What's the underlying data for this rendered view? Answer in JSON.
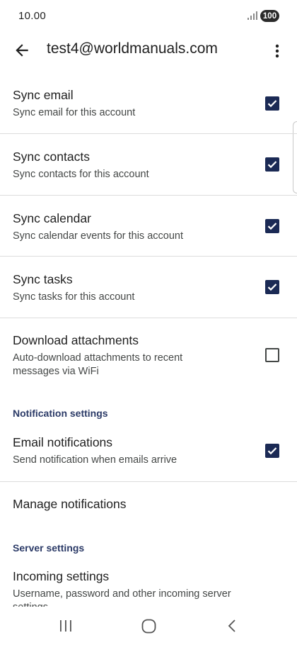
{
  "status_bar": {
    "time": "10.00",
    "battery": "100"
  },
  "app_bar": {
    "title": "test4@worldmanuals.com"
  },
  "settings": [
    {
      "title": "Sync email",
      "subtitle": "Sync email for this account",
      "checked": true
    },
    {
      "title": "Sync contacts",
      "subtitle": "Sync contacts for this account",
      "checked": true
    },
    {
      "title": "Sync calendar",
      "subtitle": "Sync calendar events for this account",
      "checked": true
    },
    {
      "title": "Sync tasks",
      "subtitle": "Sync tasks for this account",
      "checked": true
    },
    {
      "title": "Download attachments",
      "subtitle": "Auto-download attachments to recent messages via WiFi",
      "checked": false
    }
  ],
  "notification_section": {
    "header": "Notification settings",
    "email_notifications": {
      "title": "Email notifications",
      "subtitle": "Send notification when emails arrive",
      "checked": true
    },
    "manage_notifications": {
      "title": "Manage notifications"
    }
  },
  "server_section": {
    "header": "Server settings",
    "incoming": {
      "title": "Incoming settings",
      "subtitle": "Username, password and other incoming server settings"
    }
  },
  "icons": {
    "back": "back-arrow-icon",
    "more": "more-vert-icon",
    "signal": "signal-icon",
    "checkbox": "check-icon",
    "nav_recents": "recents-icon",
    "nav_home": "home-icon",
    "nav_back": "nav-back-icon"
  },
  "colors": {
    "accent": "#1b2a55",
    "section_header": "#2b3a67",
    "divider": "#dcdcdc"
  }
}
